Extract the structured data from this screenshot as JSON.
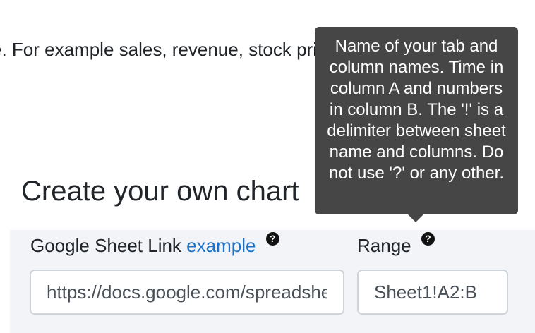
{
  "intro": {
    "text": "e. For example sales, revenue, stock price)"
  },
  "section": {
    "heading": "Create your own chart"
  },
  "form": {
    "sheet_link": {
      "label": "Google Sheet Link",
      "example_link": "example",
      "help_icon": "question-circle-icon",
      "value": "https://docs.google.com/spreadsheets"
    },
    "range": {
      "label": "Range",
      "help_icon": "question-circle-icon",
      "value": "Sheet1!A2:B"
    }
  },
  "tooltip": {
    "text": "Name of your tab and column names. Time in column A and numbers in column B. The '!' is a delimiter between sheet name and columns. Do not use '?' or any other."
  },
  "colors": {
    "link": "#1a73c8",
    "tooltip_bg": "#464646",
    "panel_bg": "#f2f4f7",
    "input_border": "#ced4da"
  }
}
